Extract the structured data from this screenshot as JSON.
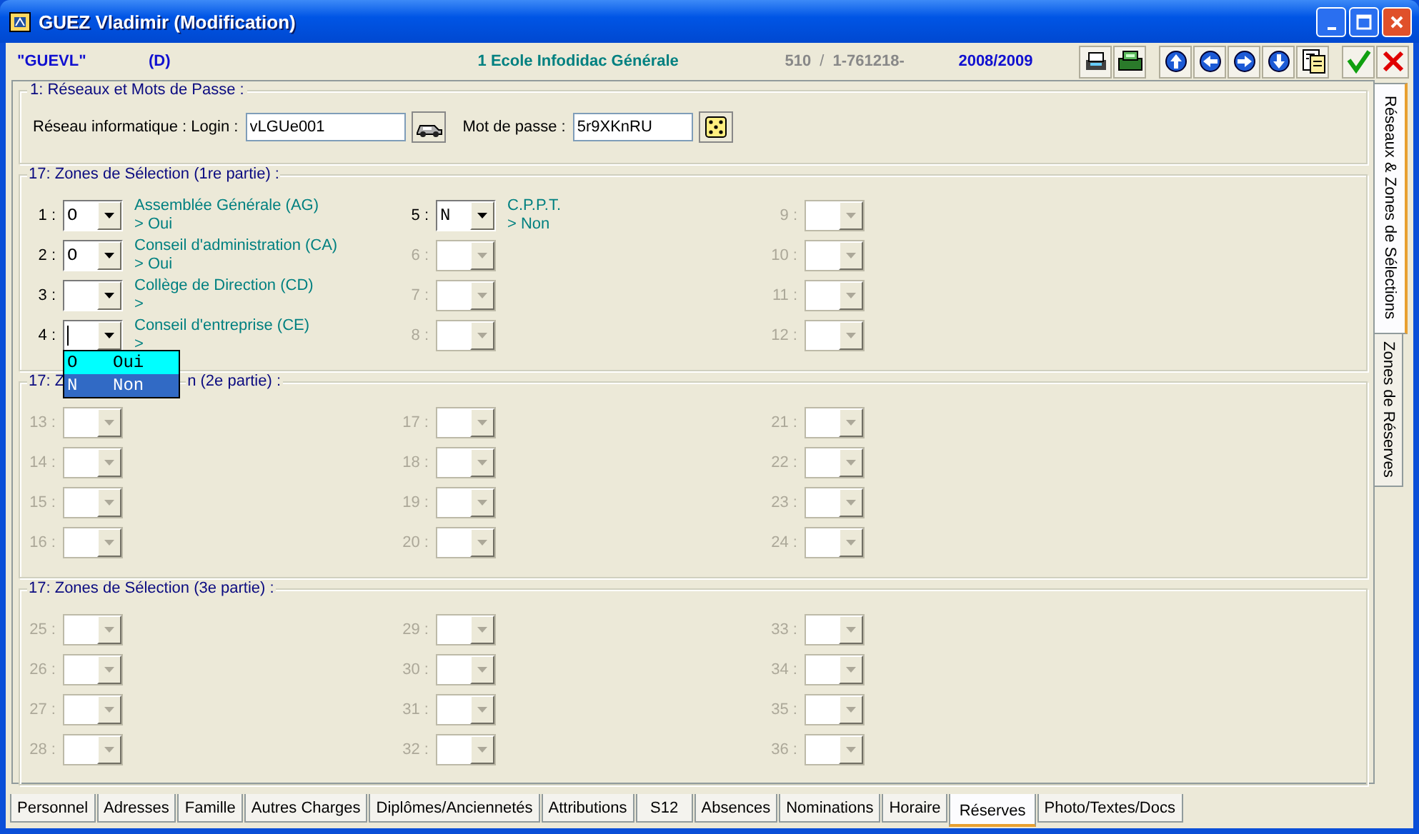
{
  "window": {
    "title": "GUEZ Vladimir (Modification)"
  },
  "header": {
    "code": "\"GUEVL\"",
    "flag": "(D)",
    "school": "1 Ecole Infodidac Générale",
    "number": "510",
    "separator": "/",
    "reference": "1-761218-",
    "year": "2008/2009"
  },
  "toolbar": [
    {
      "kind": "scanner"
    },
    {
      "kind": "register"
    },
    {
      "kind": "up"
    },
    {
      "kind": "left"
    },
    {
      "kind": "right"
    },
    {
      "kind": "down"
    },
    {
      "kind": "document"
    },
    {
      "kind": "accept"
    },
    {
      "kind": "cancel"
    }
  ],
  "network": {
    "title": "1: Réseaux et Mots de Passe :",
    "login_label": "Réseau informatique : Login :",
    "login": "vLGUe001",
    "password_label": "Mot de passe :",
    "password": "5r9XKnRU"
  },
  "zone_sections": [
    {
      "title_parts": [
        "17: Zones de Sélection (1re partie) :"
      ],
      "zones": [
        {
          "number": "1 :",
          "value": "O",
          "disabled": false,
          "description": "Assemblée Générale (AG)",
          "answer": "> Oui"
        },
        {
          "number": "2 :",
          "value": "O",
          "disabled": false,
          "description": "Conseil d'administration (CA)",
          "answer": "> Oui"
        },
        {
          "number": "3 :",
          "disabled": false,
          "description": "Collège de Direction (CD)",
          "answer": ">"
        },
        {
          "number": "4 :",
          "disabled": false,
          "focused": true,
          "description": "Conseil d'entreprise (CE)",
          "answer": ">",
          "dropdown": [
            {
              "code": "O",
              "label": "Oui",
              "selected": false
            },
            {
              "code": "N",
              "label": "Non",
              "selected": true
            }
          ]
        },
        {
          "number": "5 :",
          "value": "N",
          "disabled": false,
          "description": "C.P.P.T.",
          "answer": "> Non"
        },
        {
          "number": "6 :",
          "disabled": true
        },
        {
          "number": "7 :",
          "disabled": true
        },
        {
          "number": "8 :",
          "disabled": true
        },
        {
          "number": "9 :",
          "disabled": true
        },
        {
          "number": "10 :",
          "disabled": true
        },
        {
          "number": "11 :",
          "disabled": true
        },
        {
          "number": "12 :",
          "disabled": true
        }
      ]
    },
    {
      "title_parts": [
        "17: Z",
        "n (2e partie) :"
      ],
      "zones": [
        {
          "number": "13 :",
          "disabled": true
        },
        {
          "number": "14 :",
          "disabled": true
        },
        {
          "number": "15 :",
          "disabled": true
        },
        {
          "number": "16 :",
          "disabled": true
        },
        {
          "number": "17 :",
          "disabled": true
        },
        {
          "number": "18 :",
          "disabled": true
        },
        {
          "number": "19 :",
          "disabled": true
        },
        {
          "number": "20 :",
          "disabled": true
        },
        {
          "number": "21 :",
          "disabled": true
        },
        {
          "number": "22 :",
          "disabled": true
        },
        {
          "number": "23 :",
          "disabled": true
        },
        {
          "number": "24 :",
          "disabled": true
        }
      ]
    },
    {
      "title_parts": [
        "17: Zones de Sélection (3e partie) :"
      ],
      "zones": [
        {
          "number": "25 :",
          "disabled": true
        },
        {
          "number": "26 :",
          "disabled": true
        },
        {
          "number": "27 :",
          "disabled": true
        },
        {
          "number": "28 :",
          "disabled": true
        },
        {
          "number": "29 :",
          "disabled": true
        },
        {
          "number": "30 :",
          "disabled": true
        },
        {
          "number": "31 :",
          "disabled": true
        },
        {
          "number": "32 :",
          "disabled": true
        },
        {
          "number": "33 :",
          "disabled": true
        },
        {
          "number": "34 :",
          "disabled": true
        },
        {
          "number": "35 :",
          "disabled": true
        },
        {
          "number": "36 :",
          "disabled": true
        }
      ]
    }
  ],
  "side_tabs": [
    {
      "label": "Réseaux & Zones de Sélections",
      "selected": true
    },
    {
      "label": "Zones de Réserves",
      "selected": false
    }
  ],
  "tabs": [
    {
      "label": "Personnel",
      "selected": false
    },
    {
      "label": "Adresses",
      "selected": false
    },
    {
      "label": "Famille",
      "selected": false
    },
    {
      "label": "Autres Charges",
      "selected": false
    },
    {
      "label": "Diplômes/Anciennetés",
      "selected": false
    },
    {
      "label": "Attributions",
      "selected": false
    },
    {
      "label": "S12",
      "selected": false
    },
    {
      "label": "Absences",
      "selected": false
    },
    {
      "label": "Nominations",
      "selected": false
    },
    {
      "label": "Horaire",
      "selected": false
    },
    {
      "label": "Réserves",
      "selected": true
    },
    {
      "label": "Photo/Textes/Docs",
      "selected": false
    }
  ]
}
